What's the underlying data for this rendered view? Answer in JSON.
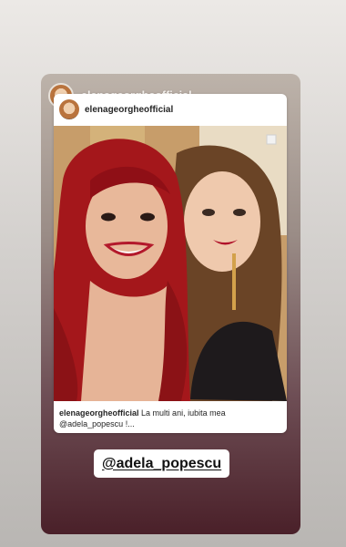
{
  "story": {
    "username": "elenageorgheofficial"
  },
  "post_card": {
    "username": "elenageorgheofficial",
    "caption_user": "elenageorgheofficial",
    "caption_text": "La multi ani, iubita mea @adela_popescu !..."
  },
  "mention_sticker": {
    "label": "@adela_popescu"
  },
  "colors": {
    "story_top": "#bdb3aa",
    "story_bottom": "#4a2029",
    "red_hair": "#a4171b"
  }
}
